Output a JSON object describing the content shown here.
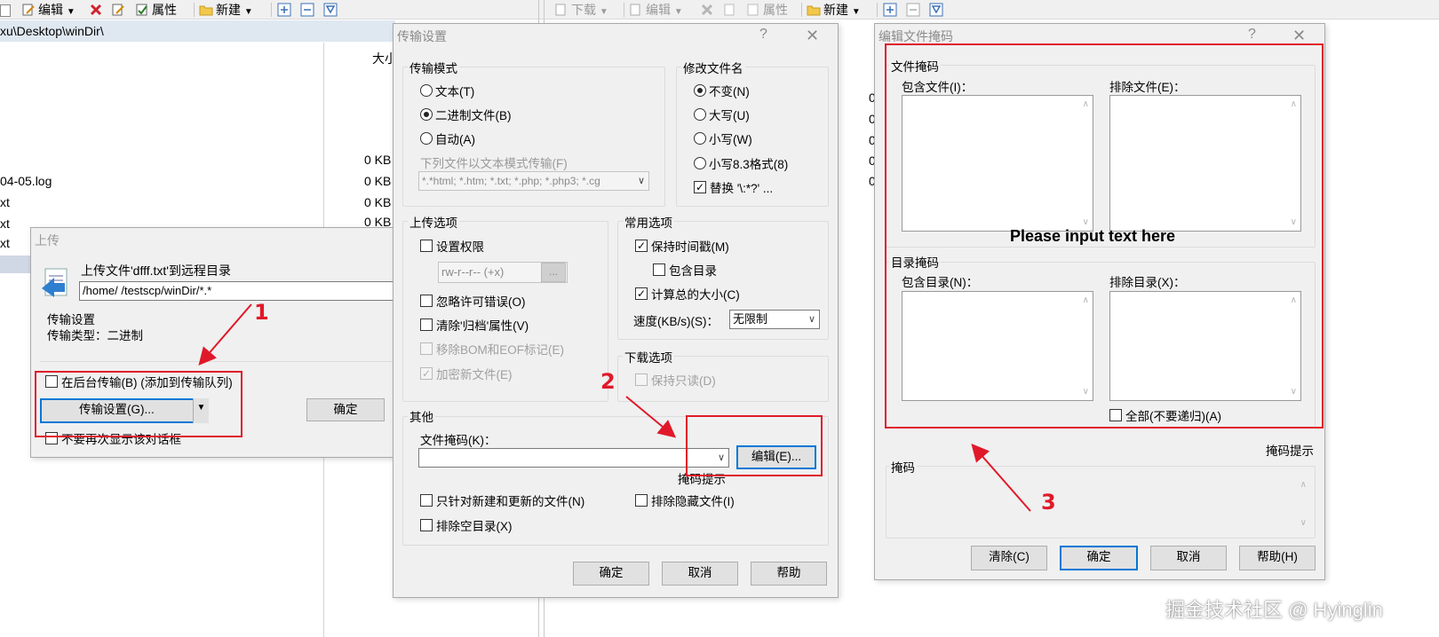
{
  "toolbar_left": {
    "edit": "编辑",
    "properties": "属性",
    "new": "新建"
  },
  "toolbar_right": {
    "download": "下载",
    "edit": "编辑",
    "properties": "属性",
    "new": "新建"
  },
  "path": "xu\\Desktop\\winDir\\",
  "file_list": {
    "size_header": "大小",
    "names": [
      "04-05.log",
      "xt",
      "xt",
      "xt"
    ],
    "sizes": [
      "0 KB",
      "0 KB",
      "0 KB",
      "0 KB"
    ],
    "right_pane_values": [
      "0",
      "0",
      "0",
      "0",
      "0"
    ]
  },
  "upload_dialog": {
    "title": "上传",
    "upload_prefix": "上传文件'dfff.txt'到远程目录",
    "path_value": "/home/    /testscp/winDir/*.*",
    "settings_label": "传输设置",
    "transfer_type": "传输类型：二进制",
    "background_check": "在后台传输(B) (添加到传输队列)",
    "settings_button": "传输设置(G)...",
    "ok_button": "确定",
    "no_show_check": "不要再次显示该对话框"
  },
  "transfer_dialog": {
    "title": "传输设置",
    "help_icon": "?",
    "mode_group": "传输模式",
    "mode_text": "文本(T)",
    "mode_binary": "二进制文件(B)",
    "mode_auto": "自动(A)",
    "text_mode_files_label": "下列文件以文本模式传输(F)",
    "text_mode_files_value": "*.*html; *.htm; *.txt; *.php; *.php3; *.cg",
    "rename_group": "修改文件名",
    "rename_unchanged": "不变(N)",
    "rename_upper": "大写(U)",
    "rename_lower": "小写(W)",
    "rename_lower83": "小写8.3格式(8)",
    "rename_replace": "替换 '\\:*?' ...",
    "upload_group": "上传选项",
    "set_permissions": "设置权限",
    "permissions_value": "rw-r--r-- (+x)",
    "permissions_btn": "...",
    "ignore_perm_errors": "忽略许可错误(O)",
    "clear_archive": "清除'归档'属性(V)",
    "remove_bom": "移除BOM和EOF标记(E)",
    "encrypt_new": "加密新文件(E)",
    "common_group": "常用选项",
    "keep_timestamp": "保持时间戳(M)",
    "include_dirs": "包含目录",
    "calc_total": "计算总的大小(C)",
    "speed_label": "速度(KB/s)(S)：",
    "speed_value": "无限制",
    "download_group": "下载选项",
    "keep_readonly": "保持只读(D)",
    "other_group": "其他",
    "file_mask_label": "文件掩码(K)：",
    "edit_button": "编辑(E)...",
    "mask_hint": "掩码提示",
    "only_new": "只针对新建和更新的文件(N)",
    "exclude_hidden": "排除隐藏文件(I)",
    "exclude_empty": "排除空目录(X)",
    "ok": "确定",
    "cancel": "取消",
    "help": "帮助"
  },
  "mask_dialog": {
    "title": "编辑文件掩码",
    "help_icon": "?",
    "file_mask_group": "文件掩码",
    "include_files": "包含文件(I)：",
    "exclude_files": "排除文件(E)：",
    "placeholder_overlay": "Please input text here",
    "dir_mask_group": "目录掩码",
    "include_dirs": "包含目录(N)：",
    "exclude_dirs": "排除目录(X)：",
    "all_no_recurse": "全部(不要递归)(A)",
    "mask_hint": "掩码提示",
    "mask_group": "掩码",
    "clear": "清除(C)",
    "ok": "确定",
    "cancel": "取消",
    "help": "帮助(H)"
  },
  "annotations": {
    "n1": "1",
    "n2": "2",
    "n3": "3",
    "color": "#e0192a"
  },
  "watermark": "掘金技术社区 @ Hyinglin"
}
